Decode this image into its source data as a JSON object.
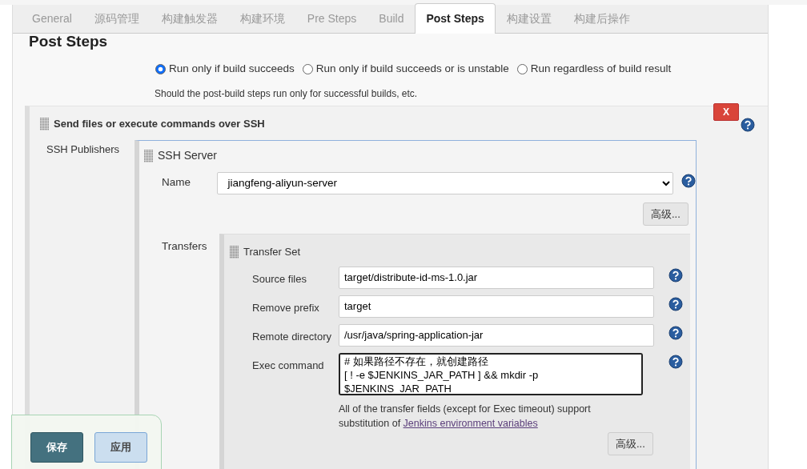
{
  "tabs": [
    {
      "label": "General",
      "selected": false
    },
    {
      "label": "源码管理",
      "selected": false
    },
    {
      "label": "构建触发器",
      "selected": false
    },
    {
      "label": "构建环境",
      "selected": false
    },
    {
      "label": "Pre Steps",
      "selected": false
    },
    {
      "label": "Build",
      "selected": false
    },
    {
      "label": "Post Steps",
      "selected": true
    },
    {
      "label": "构建设置",
      "selected": false
    },
    {
      "label": "构建后操作",
      "selected": false
    }
  ],
  "section_title": "Post Steps",
  "run_condition": {
    "options": [
      {
        "label": "Run only if build succeeds",
        "selected": true
      },
      {
        "label": "Run only if build succeeds or is unstable",
        "selected": false
      },
      {
        "label": "Run regardless of build result",
        "selected": false
      }
    ],
    "hint": "Should the post-build steps run only for successful builds, etc."
  },
  "step": {
    "title": "Send files or execute commands over SSH",
    "delete_label": "X",
    "publishers_label": "SSH Publishers",
    "server": {
      "title": "SSH Server",
      "name_label": "Name",
      "name_value": "jiangfeng-aliyun-server",
      "advanced_label": "高级...",
      "transfers_label": "Transfers",
      "transfer_set": {
        "title": "Transfer Set",
        "fields": [
          {
            "label": "Source files",
            "kind": "input",
            "value": "target/distribute-id-ms-1.0.jar"
          },
          {
            "label": "Remove prefix",
            "kind": "input",
            "value": "target"
          },
          {
            "label": "Remote directory",
            "kind": "input",
            "value": "/usr/java/spring-application-jar"
          },
          {
            "label": "Exec command",
            "kind": "textarea",
            "value": "# 如果路径不存在，就创建路径\n[ ! -e $JENKINS_JAR_PATH ] && mkdir -p\n$JENKINS_JAR_PATH"
          }
        ],
        "note": "All of the transfer fields (except for Exec timeout) support substitution of",
        "note_link": "Jenkins environment variables",
        "advanced_label": "高级..."
      }
    }
  },
  "actions": [
    {
      "label": "保存",
      "kind": "primary"
    },
    {
      "label": "应用",
      "kind": "secondary"
    }
  ]
}
